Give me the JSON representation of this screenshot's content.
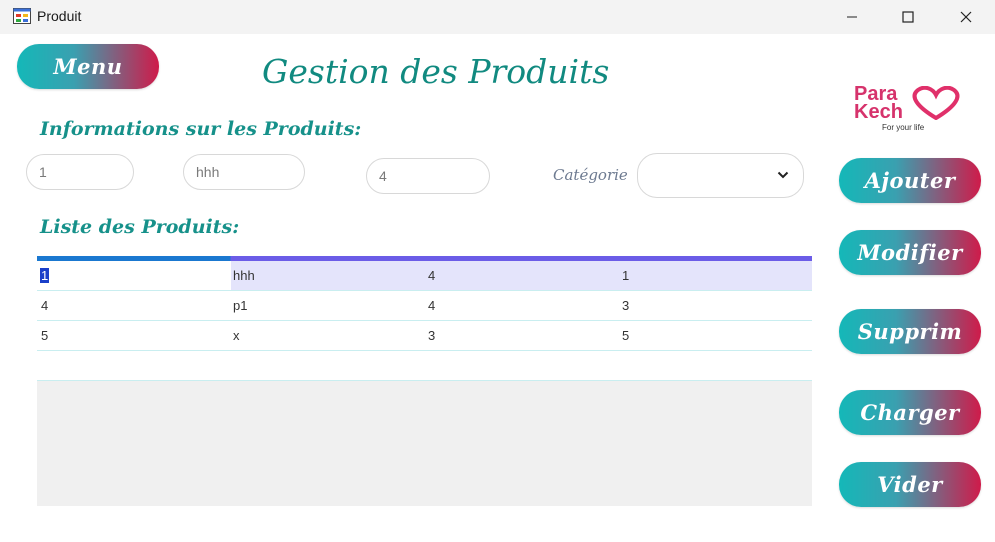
{
  "window": {
    "title": "Produit"
  },
  "menu_button": "Menu",
  "page_title": "Gestion des Produits",
  "logo": {
    "line1": "Para",
    "line2": "Kech",
    "tagline": "For your life"
  },
  "info_section": "Informations sur les Produits:",
  "fields": {
    "id_value": "1",
    "name_value": "hhh",
    "qty_value": "4",
    "category_label": "Catégorie",
    "category_value": ""
  },
  "list_section": "Liste des Produits:",
  "table": {
    "rows": [
      [
        "1",
        "hhh",
        "4",
        "1"
      ],
      [
        "4",
        "p1",
        "4",
        "3"
      ],
      [
        "5",
        "x",
        "3",
        "5"
      ]
    ],
    "selected_row": 0
  },
  "actions": {
    "add": "Ajouter",
    "edit": "Modifier",
    "delete": "Supprim",
    "load": "Charger",
    "clear": "Vider"
  },
  "colors": {
    "gradient_start": "#14b8b8",
    "gradient_end": "#cf1b4a",
    "title": "#118a80",
    "logo_text": "#d6336c"
  },
  "icons": {
    "app": "form-icon",
    "minimize": "minimize-icon",
    "maximize": "maximize-icon",
    "close": "close-icon",
    "dropdown": "chevron-down-icon",
    "logo_heart": "heart-icon"
  }
}
